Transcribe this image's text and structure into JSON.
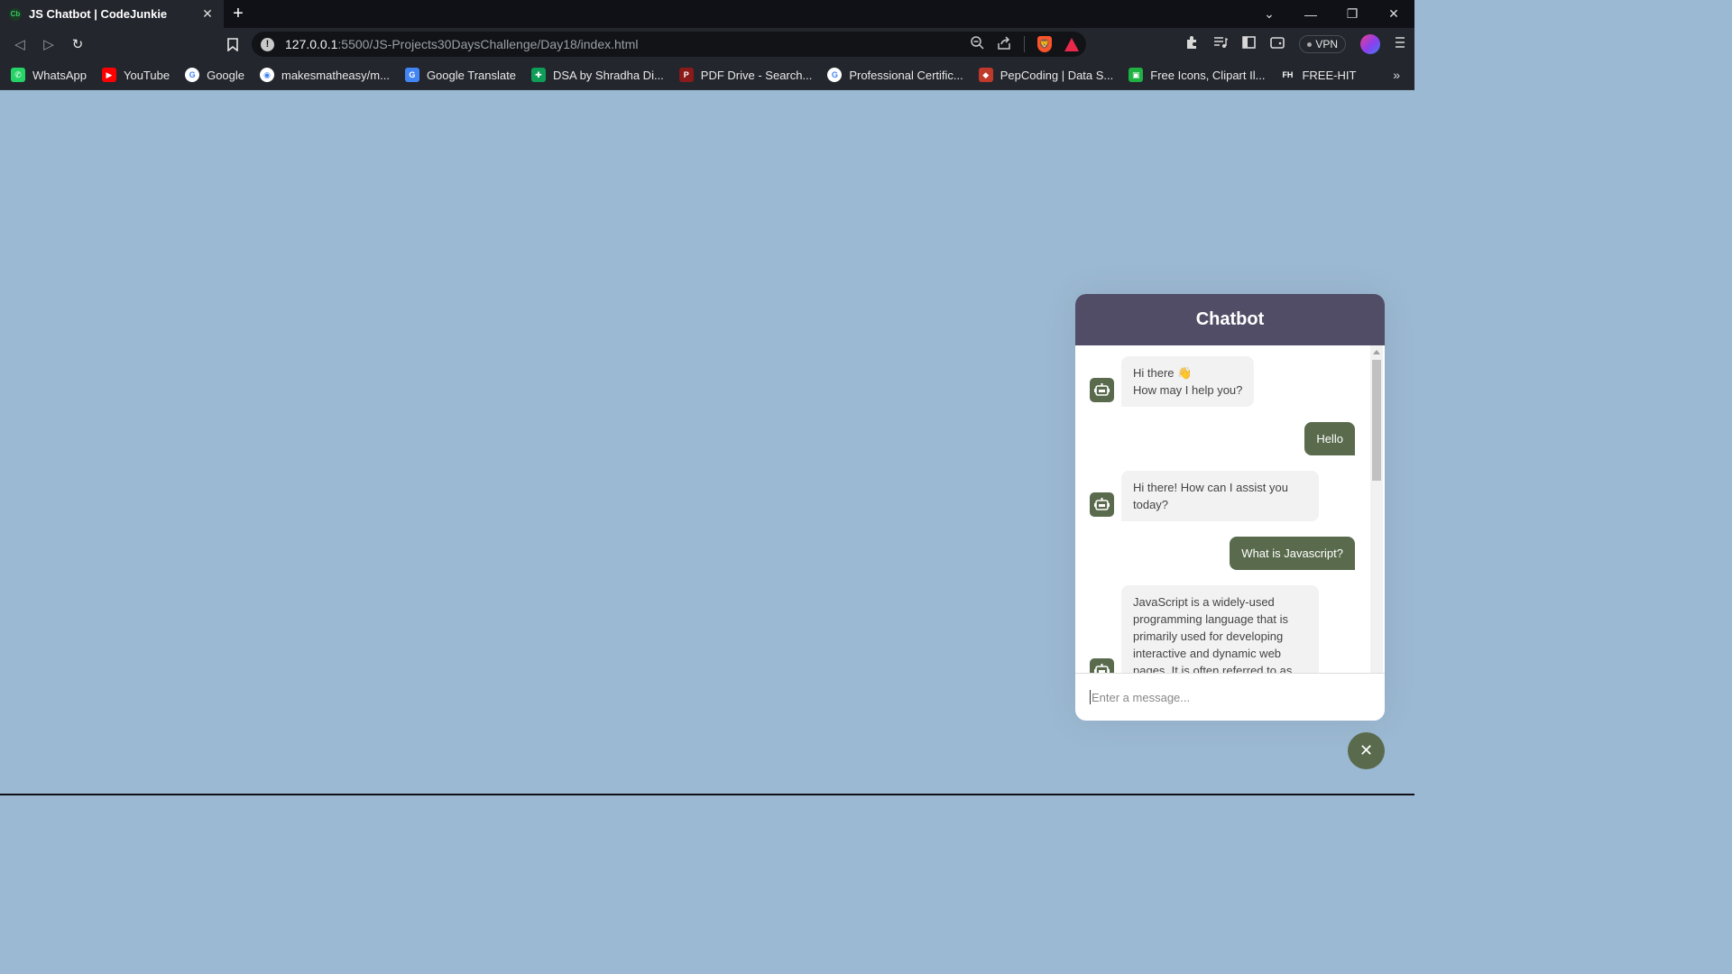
{
  "browser": {
    "tab": {
      "favicon_text": "Cb",
      "title": "JS Chatbot | CodeJunkie",
      "close": "✕"
    },
    "new_tab": "+",
    "window_controls": {
      "tabs_menu": "⌄",
      "minimize": "—",
      "restore": "❐",
      "close": "✕"
    },
    "nav": {
      "back": "◁",
      "forward": "▷",
      "reload": "↻",
      "bookmark": "🔖"
    },
    "address": {
      "host": "127.0.0.1",
      "path": ":5500/JS-Projects30DaysChallenge/Day18/index.html"
    },
    "vpn_label": "VPN",
    "bookmarks": [
      {
        "label": "WhatsApp",
        "icon": "whatsapp-icon",
        "color": "#25d366",
        "glyph": "✆"
      },
      {
        "label": "YouTube",
        "icon": "youtube-icon",
        "color": "#ff0000",
        "glyph": "▶"
      },
      {
        "label": "Google",
        "icon": "google-icon",
        "color": "#ffffff",
        "glyph": "G"
      },
      {
        "label": "makesmatheasy/m...",
        "icon": "github-icon",
        "color": "#ffffff",
        "glyph": "◉"
      },
      {
        "label": "Google Translate",
        "icon": "translate-icon",
        "color": "#4285f4",
        "glyph": "G"
      },
      {
        "label": "DSA by Shradha Di...",
        "icon": "sheets-icon",
        "color": "#0f9d58",
        "glyph": "✚"
      },
      {
        "label": "PDF Drive - Search...",
        "icon": "pdf-icon",
        "color": "#8b1a1a",
        "glyph": "P"
      },
      {
        "label": "Professional Certific...",
        "icon": "google-icon",
        "color": "#ffffff",
        "glyph": "G"
      },
      {
        "label": "PepCoding | Data S...",
        "icon": "pepcoding-icon",
        "color": "#c0392b",
        "glyph": "◆"
      },
      {
        "label": "Free Icons, Clipart Il...",
        "icon": "icons8-icon",
        "color": "#1fb141",
        "glyph": "▣"
      },
      {
        "label": "FREE-HIT",
        "icon": "freehit-icon",
        "color": "#23262d",
        "glyph": "FH"
      }
    ],
    "bookmarks_more": "»"
  },
  "chatbot": {
    "title": "Chatbot",
    "messages": [
      {
        "type": "incoming",
        "text": "Hi there 👋\n How may I help you?"
      },
      {
        "type": "outgoing",
        "text": "Hello"
      },
      {
        "type": "incoming",
        "text": "Hi there! How can I assist you today?"
      },
      {
        "type": "outgoing",
        "text": "What is Javascript?"
      },
      {
        "type": "incoming",
        "text": "JavaScript is a widely-used programming language that is primarily used for developing interactive and dynamic web pages. It is often referred to as"
      }
    ],
    "input_placeholder": "Enter a message...",
    "close_toggle": "✕"
  },
  "colors": {
    "page_bg": "#9cb9d3",
    "header": "#514d66",
    "accent": "#5a6b4d"
  }
}
